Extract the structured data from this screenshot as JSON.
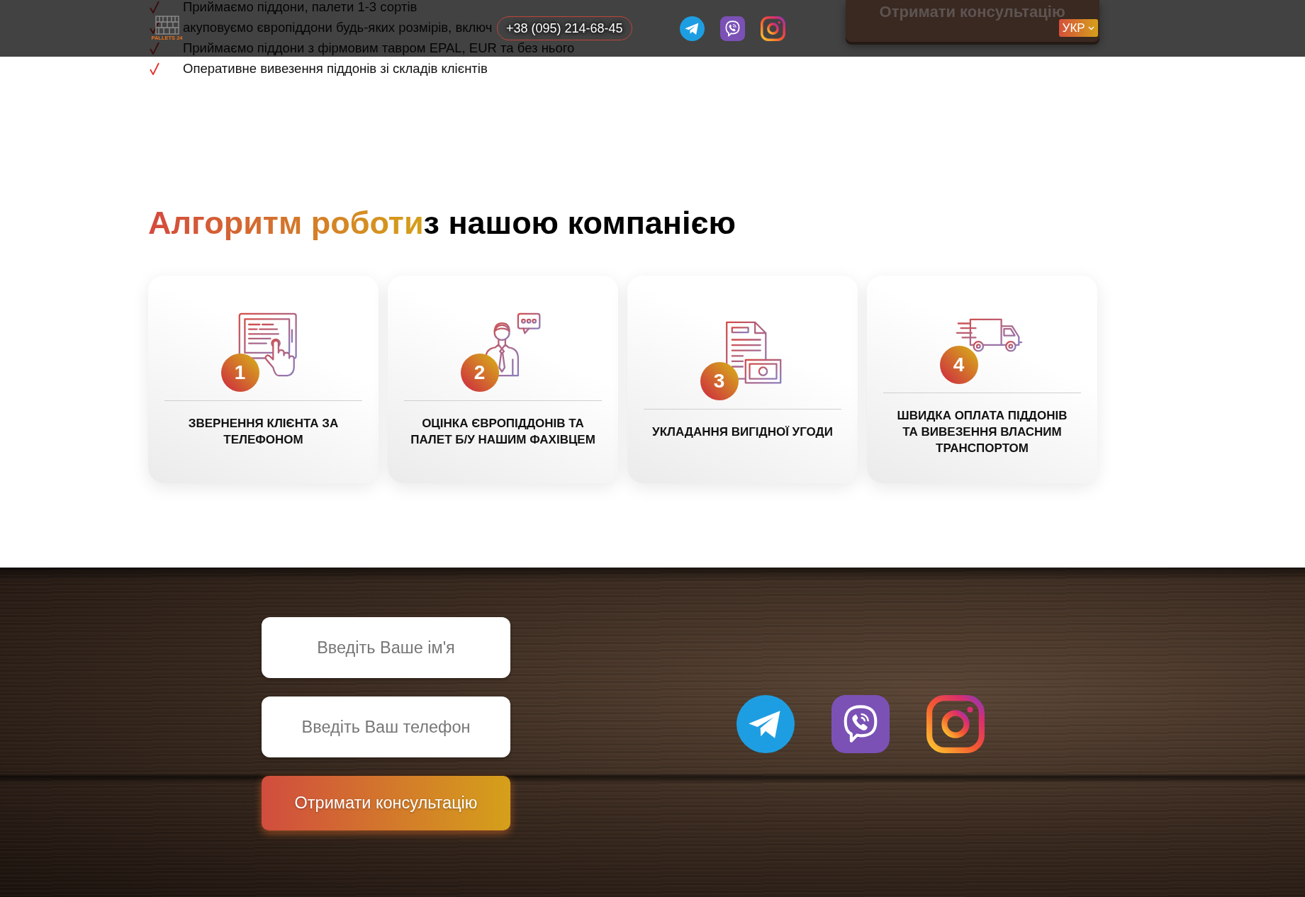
{
  "benefits": [
    "Приймаємо піддони, палети 1-3 сортів",
    "акуповуємо європіддони будь-яких розмірів, включ",
    "Приймаємо піддони з фірмовим тавром EPAL, EUR та без нього",
    "Оперативне вивезення піддонів зі складів клієнтів"
  ],
  "header": {
    "logo_text": "PALLETS 24",
    "phone": "+38 (095) 214-68-45",
    "socials": [
      {
        "kind": "telegram"
      },
      {
        "kind": "viber"
      },
      {
        "kind": "instagram"
      }
    ],
    "cta": "Отримати консультацію",
    "language": "УКР"
  },
  "section": {
    "title_accent": "Алгоритм роботи",
    "title_rest": "з нашою компанією",
    "steps": [
      {
        "number": "1",
        "kind": "tablet",
        "title": "ЗВЕРНЕННЯ КЛІЄНТА ЗА ТЕЛЕФОНОМ"
      },
      {
        "number": "2",
        "kind": "consultant",
        "title": "ОЦІНКА ЄВРОПІДДОНІВ ТА ПАЛЕТ Б/У НАШИМ ФАХІВЦЕМ"
      },
      {
        "number": "3",
        "kind": "contract",
        "title": "УКЛАДАННЯ ВИГІДНОЇ УГОДИ"
      },
      {
        "number": "4",
        "kind": "truck",
        "title": "ШВИДКА ОПЛАТА ПІДДОНІВ ТА ВИВЕЗЕННЯ ВЛАСНИМ ТРАНСПОРТОМ"
      }
    ]
  },
  "contact_form": {
    "fields": [
      {
        "placeholder": "Введіть Ваше ім'я"
      },
      {
        "placeholder": "Введіть Ваш телефон"
      }
    ],
    "submit": "Отримати консультацію",
    "socials": [
      {
        "kind": "telegram"
      },
      {
        "kind": "viber"
      },
      {
        "kind": "instagram"
      }
    ]
  }
}
